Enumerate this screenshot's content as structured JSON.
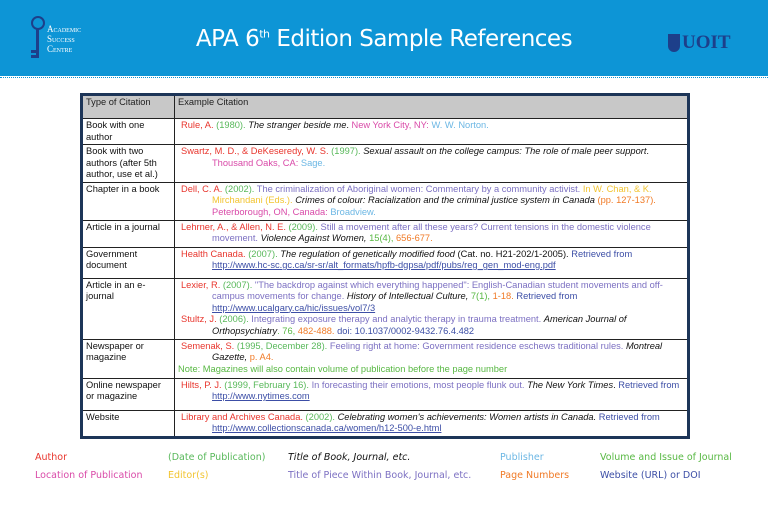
{
  "header": {
    "logo_left": [
      "Academic",
      "Success",
      "Centre"
    ],
    "title_main": "APA 6",
    "title_sup": "th",
    "title_rest": " Edition Sample References",
    "logo_right": "UOIT"
  },
  "table": {
    "headers": [
      "Type of Citation",
      "Example Citation"
    ],
    "rows": [
      {
        "type": "Book with one author",
        "lines": [
          [
            {
              "t": "Rule, A. ",
              "c": "author"
            },
            {
              "t": "(1980). ",
              "c": "date"
            },
            {
              "t": "The stranger beside me",
              "c": "title-book"
            },
            {
              "t": ". ",
              "c": "plain"
            },
            {
              "t": "New York City, NY: ",
              "c": "loc"
            },
            {
              "t": "W. W. Norton.",
              "c": "pub"
            }
          ]
        ]
      },
      {
        "type": "Book with two authors (after 5th author, use et al.)",
        "lines": [
          [
            {
              "t": "Swartz, M. D., & DeKeseredy, W. S. ",
              "c": "author"
            },
            {
              "t": "(1997). ",
              "c": "date"
            },
            {
              "t": "Sexual assault on the college campus: The role of male peer support",
              "c": "title-book"
            },
            {
              "t": ". ",
              "c": "plain"
            },
            {
              "t": "Thousand Oaks, CA: ",
              "c": "loc"
            },
            {
              "t": "Sage.",
              "c": "pub"
            }
          ]
        ]
      },
      {
        "type": "Chapter in a book",
        "lines": [
          [
            {
              "t": "Dell, C. A. ",
              "c": "author"
            },
            {
              "t": "(2002). ",
              "c": "date"
            },
            {
              "t": "The criminalization of Aboriginal women: Commentary by a community activist. ",
              "c": "title-piece"
            },
            {
              "t": "In W. Chan, & K. Mirchandani (Eds.). ",
              "c": "ed"
            },
            {
              "t": "Crimes of colour: Racialization and the criminal justice system in Canada ",
              "c": "title-book"
            },
            {
              "t": "(pp. 127-137). ",
              "c": "pages"
            },
            {
              "t": "Peterborough, ON, Canada: ",
              "c": "loc"
            },
            {
              "t": "Broadview.",
              "c": "pub"
            }
          ]
        ]
      },
      {
        "type": "Article in a journal",
        "lines": [
          [
            {
              "t": "Lehrner, A., & Allen, N. E. ",
              "c": "author"
            },
            {
              "t": "(2009). ",
              "c": "date"
            },
            {
              "t": "Still a movement after all these years? Current tensions in the domestic violence movement. ",
              "c": "title-piece"
            },
            {
              "t": "Violence Against Women, ",
              "c": "title-book"
            },
            {
              "t": "15(4), ",
              "c": "vol"
            },
            {
              "t": "656-677.",
              "c": "pages"
            }
          ]
        ]
      },
      {
        "type": "Government document",
        "lines": [
          [
            {
              "t": "Health Canada. ",
              "c": "author"
            },
            {
              "t": "(2007). ",
              "c": "date"
            },
            {
              "t": "The regulation of genetically modified food ",
              "c": "title-book"
            },
            {
              "t": "(Cat. no. H21-202/1-2005). ",
              "c": "plain"
            },
            {
              "t": "Retrieved from ",
              "c": "url"
            },
            {
              "t": "http://www.hc-sc.gc.ca/sr-sr/alt_formats/hpfb-dgpsa/pdf/pubs/reg_gen_mod-eng.pdf",
              "c": "url-link"
            }
          ]
        ]
      },
      {
        "type": "Article in an e-journal",
        "lines": [
          [
            {
              "t": "Lexier, R. ",
              "c": "author"
            },
            {
              "t": "(2007). ",
              "c": "date"
            },
            {
              "t": "\"The backdrop against which everything happened\": English-Canadian student movements and off-campus movements for change. ",
              "c": "title-piece"
            },
            {
              "t": "History of Intellectual Culture, ",
              "c": "title-book"
            },
            {
              "t": "7(1), ",
              "c": "vol"
            },
            {
              "t": "1-18. ",
              "c": "pages"
            },
            {
              "t": "Retrieved from ",
              "c": "url"
            },
            {
              "t": "http://www.ucalgary.ca/hic/issues/vol7/3",
              "c": "url-link"
            }
          ],
          [
            {
              "t": "Stultz, J. ",
              "c": "author"
            },
            {
              "t": "(2006). ",
              "c": "date"
            },
            {
              "t": "Integrating exposure therapy and analytic therapy in trauma treatment. ",
              "c": "title-piece"
            },
            {
              "t": "American Journal of Orthopsychiatry",
              "c": "title-book"
            },
            {
              "t": ". 76, ",
              "c": "vol"
            },
            {
              "t": "482-488. ",
              "c": "pages"
            },
            {
              "t": "doi: 10.1037/0002-9432.76.4.482",
              "c": "url"
            }
          ]
        ]
      },
      {
        "type": "Newspaper or magazine",
        "lines": [
          [
            {
              "t": "Semenak, S. ",
              "c": "author"
            },
            {
              "t": "(1995, December 28). ",
              "c": "date"
            },
            {
              "t": "Feeling right at home: Government residence eschews traditional rules. ",
              "c": "title-piece"
            },
            {
              "t": "Montreal Gazette, ",
              "c": "title-book"
            },
            {
              "t": "p. A4.",
              "c": "pages"
            }
          ]
        ],
        "note": "Note: Magazines will also contain volume of publication before the page number"
      },
      {
        "type": "Online newspaper or magazine",
        "lines": [
          [
            {
              "t": "Hilts, P. J. ",
              "c": "author"
            },
            {
              "t": "(1999, February 16). ",
              "c": "date"
            },
            {
              "t": "In forecasting their emotions, most people flunk out. ",
              "c": "title-piece"
            },
            {
              "t": "The New York Times",
              "c": "title-book"
            },
            {
              "t": ". ",
              "c": "plain"
            },
            {
              "t": "Retrieved from ",
              "c": "url"
            },
            {
              "t": "http://www.nytimes.com",
              "c": "url-link"
            }
          ]
        ]
      },
      {
        "type": "Website",
        "lines": [
          [
            {
              "t": "Library and Archives Canada. ",
              "c": "author"
            },
            {
              "t": "(2002). ",
              "c": "date"
            },
            {
              "t": "Celebrating women's achievements: Women artists in Canada. ",
              "c": "title-book"
            },
            {
              "t": "Retrieved from ",
              "c": "url"
            },
            {
              "t": "http://www.collectionscanada.ca/women/h12-500-e.html",
              "c": "url-link"
            }
          ]
        ]
      }
    ]
  },
  "legend": [
    {
      "label": "Author",
      "c": "author",
      "col": 0,
      "row": 0
    },
    {
      "label": "Location of Publication",
      "c": "loc",
      "col": 0,
      "row": 1
    },
    {
      "label": "(Date of Publication)",
      "c": "date",
      "col": 1,
      "row": 0
    },
    {
      "label": "Editor(s)",
      "c": "ed",
      "col": 1,
      "row": 1
    },
    {
      "label": "Title of Book, Journal, etc.",
      "c": "title-book",
      "col": 2,
      "row": 0
    },
    {
      "label": "Title of Piece Within Book, Journal, etc.",
      "c": "title-piece",
      "col": 2,
      "row": 1
    },
    {
      "label": "Publisher",
      "c": "pub",
      "col": 3,
      "row": 0
    },
    {
      "label": "Page Numbers",
      "c": "pages",
      "col": 3,
      "row": 1
    },
    {
      "label": "Volume and Issue of Journal",
      "c": "vol",
      "col": 4,
      "row": 0
    },
    {
      "label": "Website (URL) or DOI",
      "c": "url",
      "col": 4,
      "row": 1
    }
  ],
  "colors": {
    "banner": "#0d95d6",
    "author": "#e8352d",
    "date": "#58b85a",
    "location": "#d94aa8",
    "publisher": "#6cb7e4",
    "title_piece": "#7c70c2",
    "pages": "#f07a26",
    "editor": "#f2c430",
    "url": "#3c4ea6"
  }
}
